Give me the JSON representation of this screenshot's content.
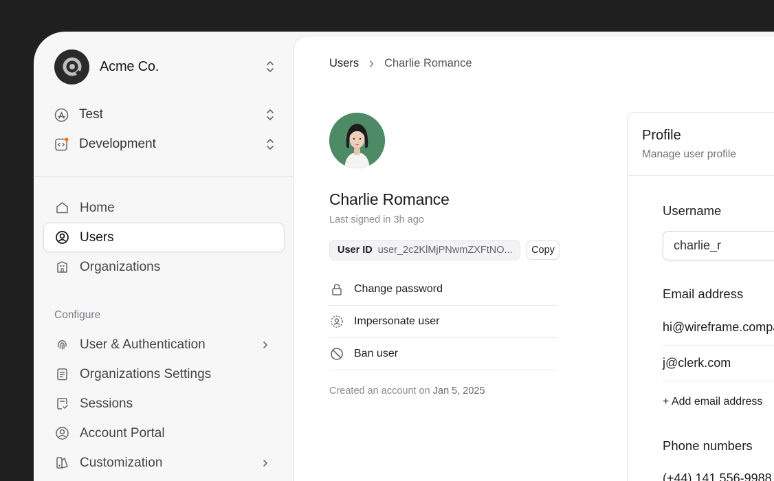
{
  "org": {
    "name": "Acme Co.",
    "logo_icon": "acme-logo-icon"
  },
  "environments": [
    {
      "label": "Test",
      "icon": "app-store-icon"
    },
    {
      "label": "Development",
      "icon": "code-icon"
    }
  ],
  "nav": {
    "items": [
      {
        "label": "Home",
        "icon": "home-icon"
      },
      {
        "label": "Users",
        "icon": "user-circle-icon",
        "active": true
      },
      {
        "label": "Organizations",
        "icon": "building-icon"
      }
    ],
    "configure_label": "Configure",
    "configure_items": [
      {
        "label": "User & Authentication",
        "icon": "fingerprint-icon",
        "has_submenu": true
      },
      {
        "label": "Organizations Settings",
        "icon": "clipboard-icon"
      },
      {
        "label": "Sessions",
        "icon": "session-icon"
      },
      {
        "label": "Account Portal",
        "icon": "user-circle-icon"
      },
      {
        "label": "Customization",
        "icon": "palette-icon",
        "has_submenu": true
      }
    ]
  },
  "breadcrumb": {
    "root": "Users",
    "current": "Charlie Romance"
  },
  "user": {
    "name": "Charlie Romance",
    "last_signed": "Last signed in 3h ago",
    "id_label": "User ID",
    "id_value": "user_2c2KlMjPNwmZXFtNO...",
    "copy_label": "Copy",
    "created_prefix": "Created an account on ",
    "created_date": "Jan 5, 2025"
  },
  "actions": [
    {
      "label": "Change password",
      "icon": "lock-icon"
    },
    {
      "label": "Impersonate user",
      "icon": "impersonate-icon"
    },
    {
      "label": "Ban user",
      "icon": "ban-icon"
    }
  ],
  "profile": {
    "title": "Profile",
    "subtitle": "Manage user profile",
    "username_label": "Username",
    "username_value": "charlie_r",
    "email_label": "Email address",
    "emails": [
      "hi@wireframe.compa",
      "j@clerk.com"
    ],
    "add_email_label": "+ Add email address",
    "phone_label": "Phone numbers",
    "phone": "(+44) 141 556-9988"
  },
  "colors": {
    "background": "#1f1f1f",
    "sidebar": "#f7f7f8",
    "main": "#ffffff",
    "accent_dot": "#f97316"
  }
}
